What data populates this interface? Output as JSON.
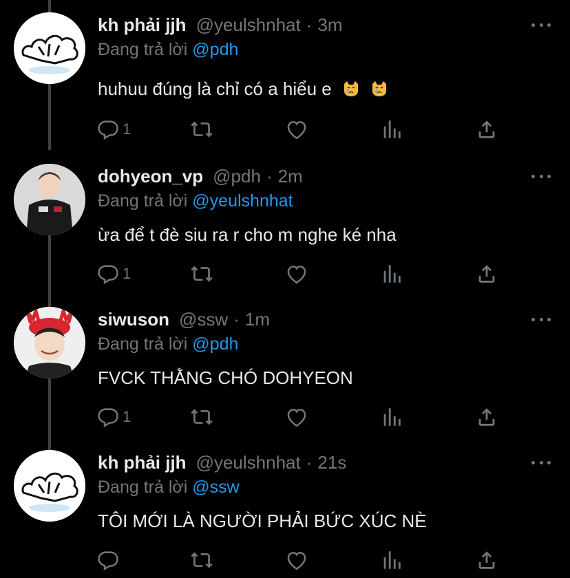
{
  "reply_prefix": "Đang trả lời",
  "tweets": [
    {
      "name": "kh phải jjh",
      "handle": "@yeulshnhat",
      "time": "3m",
      "reply_to": "@pdh",
      "text": "huhuu đúng là chỉ có a hiểu e",
      "emoji": [
        "crying-cat-face",
        "crying-cat-face"
      ],
      "reply_count": "1",
      "avatar": "cat-sketch"
    },
    {
      "name": "dohyeon_vp",
      "handle": "@pdh",
      "time": "2m",
      "reply_to": "@yeulshnhat",
      "text": "ừa để t đè siu ra r cho m nghe ké nha",
      "reply_count": "1",
      "avatar": "player-photo-edg"
    },
    {
      "name": "siwuson",
      "handle": "@ssw",
      "time": "1m",
      "reply_to": "@pdh",
      "text": "FVCK THẰNG CHÓ DOHYEON",
      "reply_count": "1",
      "avatar": "player-photo-antlers"
    },
    {
      "name": "kh phải jjh",
      "handle": "@yeulshnhat",
      "time": "21s",
      "reply_to": "@ssw",
      "text": "TÔI MỚI LÀ NGƯỜI PHẢI BỨC XÚC NÈ",
      "reply_count": "",
      "avatar": "cat-sketch"
    }
  ],
  "colors": {
    "background": "#000000",
    "text": "#e7e9ea",
    "muted": "#71767b",
    "link": "#1d9bf0",
    "thread": "#3e4144"
  }
}
